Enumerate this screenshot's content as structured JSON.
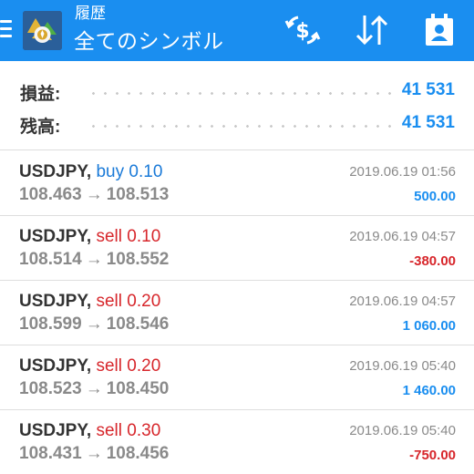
{
  "header": {
    "subtitle": "履歴",
    "title": "全てのシンボル",
    "icons": [
      "menu-icon",
      "app-logo",
      "currency-exchange-icon",
      "sort-icon",
      "calendar-contact-icon"
    ],
    "accent_color": "#1a8ef0"
  },
  "summary": {
    "profit_label": "損益:",
    "profit_value": "41 531",
    "balance_label": "残高:",
    "balance_value": "41 531"
  },
  "deals": [
    {
      "symbol": "USDJPY",
      "comma": ",",
      "direction": "buy",
      "volume": "0.10",
      "price_open": "108.463",
      "arrow": "→",
      "price_close": "108.513",
      "datetime": "2019.06.19 01:56",
      "profit": "500.00"
    },
    {
      "symbol": "USDJPY",
      "comma": ",",
      "direction": "sell",
      "volume": "0.10",
      "price_open": "108.514",
      "arrow": "→",
      "price_close": "108.552",
      "datetime": "2019.06.19 04:57",
      "profit": "-380.00"
    },
    {
      "symbol": "USDJPY",
      "comma": ",",
      "direction": "sell",
      "volume": "0.20",
      "price_open": "108.599",
      "arrow": "→",
      "price_close": "108.546",
      "datetime": "2019.06.19 04:57",
      "profit": "1 060.00"
    },
    {
      "symbol": "USDJPY",
      "comma": ",",
      "direction": "sell",
      "volume": "0.20",
      "price_open": "108.523",
      "arrow": "→",
      "price_close": "108.450",
      "datetime": "2019.06.19 05:40",
      "profit": "1 460.00"
    },
    {
      "symbol": "USDJPY",
      "comma": ",",
      "direction": "sell",
      "volume": "0.30",
      "price_open": "108.431",
      "arrow": "→",
      "price_close": "108.456",
      "datetime": "2019.06.19 05:40",
      "profit": "-750.00"
    }
  ],
  "colors": {
    "buy": "#1a7ad8",
    "sell": "#d7262b",
    "positive": "#1a8ef0",
    "negative": "#d7262b"
  }
}
